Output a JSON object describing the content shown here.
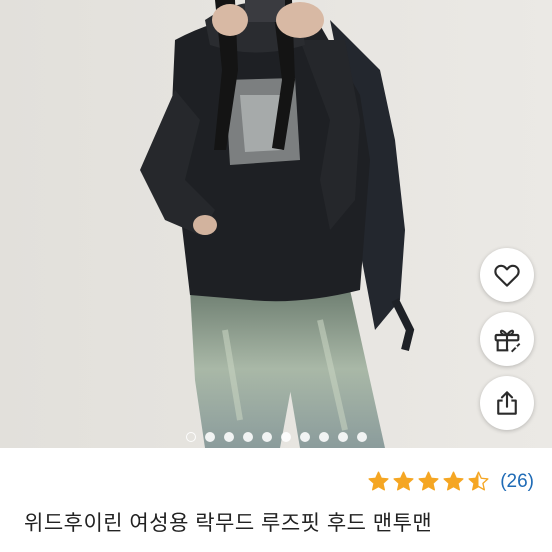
{
  "product": {
    "title": "위드후이린 여성용 락무드 루즈핏 후드 맨투맨",
    "rating_count": "(26)",
    "rating": 4.5,
    "max_rating": 5
  },
  "carousel": {
    "slide_count": 10,
    "active_index": 0
  },
  "actions": [
    "heart-icon",
    "gift-icon",
    "share-icon"
  ],
  "colors": {
    "star": "#f5a623",
    "rating_count": "#1f6bb6",
    "title": "#222222"
  }
}
